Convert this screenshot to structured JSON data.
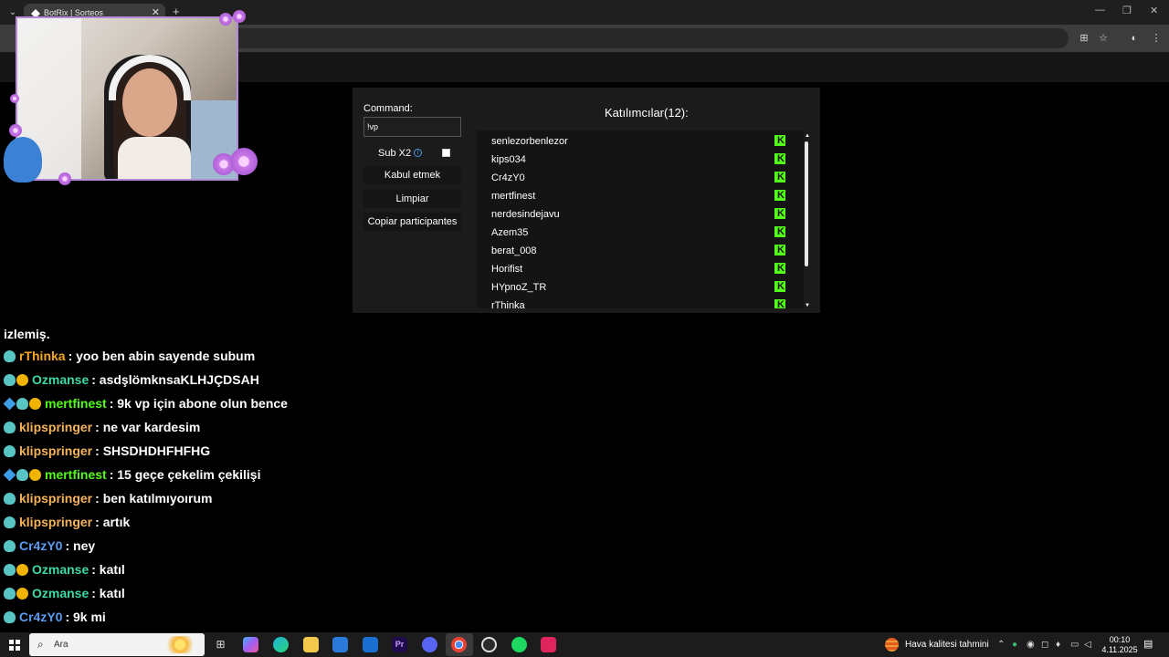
{
  "browser": {
    "tab_title": "BotRix | Sorteos",
    "new_tab_glyph": "+",
    "close_glyph": "✕",
    "window_controls": [
      "—",
      "❐",
      "✕"
    ]
  },
  "giveaway": {
    "command_label": "Command:",
    "command_value": "!vp",
    "sub_x2_label": "Sub X2",
    "sub_x2_checked": false,
    "accept_button": "Kabul etmek",
    "clear_button": "Limpiar",
    "copy_button": "Copiar participantes",
    "participants_title": "Katılımcılar(12):",
    "participants": [
      "senlezorbenlezor",
      "kips034",
      "Cr4zY0",
      "mertfinest",
      "nerdesindejavu",
      "Azem35",
      "berat_008",
      "Horifist",
      "HYpnoZ_TR",
      "rThinka"
    ],
    "platform_icon": "kick-icon",
    "accent_color": "#53fc18"
  },
  "chat": {
    "partial_first_line": "izlemiş.",
    "messages": [
      {
        "badges": [
          "sub"
        ],
        "user": "rThinka",
        "color": "#f5a623",
        "text": ": yoo ben abin sayende subum"
      },
      {
        "badges": [
          "sub",
          "gift"
        ],
        "user": "Ozmanse",
        "color": "#3dd9a7",
        "text": ": asdşlömknsaKLHJÇDSAH"
      },
      {
        "badges": [
          "cube",
          "sub",
          "gift"
        ],
        "user": "mertfinest",
        "color": "#53fc18",
        "text": ": 9k vp için abone olun bence"
      },
      {
        "badges": [
          "sub"
        ],
        "user": "klipspringer",
        "color": "#f5b35a",
        "text": ": ne var kardesim"
      },
      {
        "badges": [
          "sub"
        ],
        "user": "klipspringer",
        "color": "#f5b35a",
        "text": ": SHSDHDHFHFHG"
      },
      {
        "badges": [
          "cube",
          "sub",
          "gift"
        ],
        "user": "mertfinest",
        "color": "#53fc18",
        "text": ": 15 geçe çekelim çekilişi"
      },
      {
        "badges": [
          "sub"
        ],
        "user": "klipspringer",
        "color": "#f5b35a",
        "text": ": ben katılmıyoırum"
      },
      {
        "badges": [
          "sub"
        ],
        "user": "klipspringer",
        "color": "#f5b35a",
        "text": ": artık"
      },
      {
        "badges": [
          "sub"
        ],
        "user": "Cr4zY0",
        "color": "#5b9cf0",
        "text": ": ney"
      },
      {
        "badges": [
          "sub",
          "gift"
        ],
        "user": "Ozmanse",
        "color": "#3dd9a7",
        "text": ": katıl"
      },
      {
        "badges": [
          "sub",
          "gift"
        ],
        "user": "Ozmanse",
        "color": "#3dd9a7",
        "text": ": katıl"
      },
      {
        "badges": [
          "sub"
        ],
        "user": "Cr4zY0",
        "color": "#5b9cf0",
        "text": ": 9k mi"
      }
    ]
  },
  "taskbar": {
    "search_placeholder": "Ara",
    "weather_text": "Hava kalitesi tahmini",
    "clock_time": "00:10",
    "clock_date": "4.11.2025"
  }
}
